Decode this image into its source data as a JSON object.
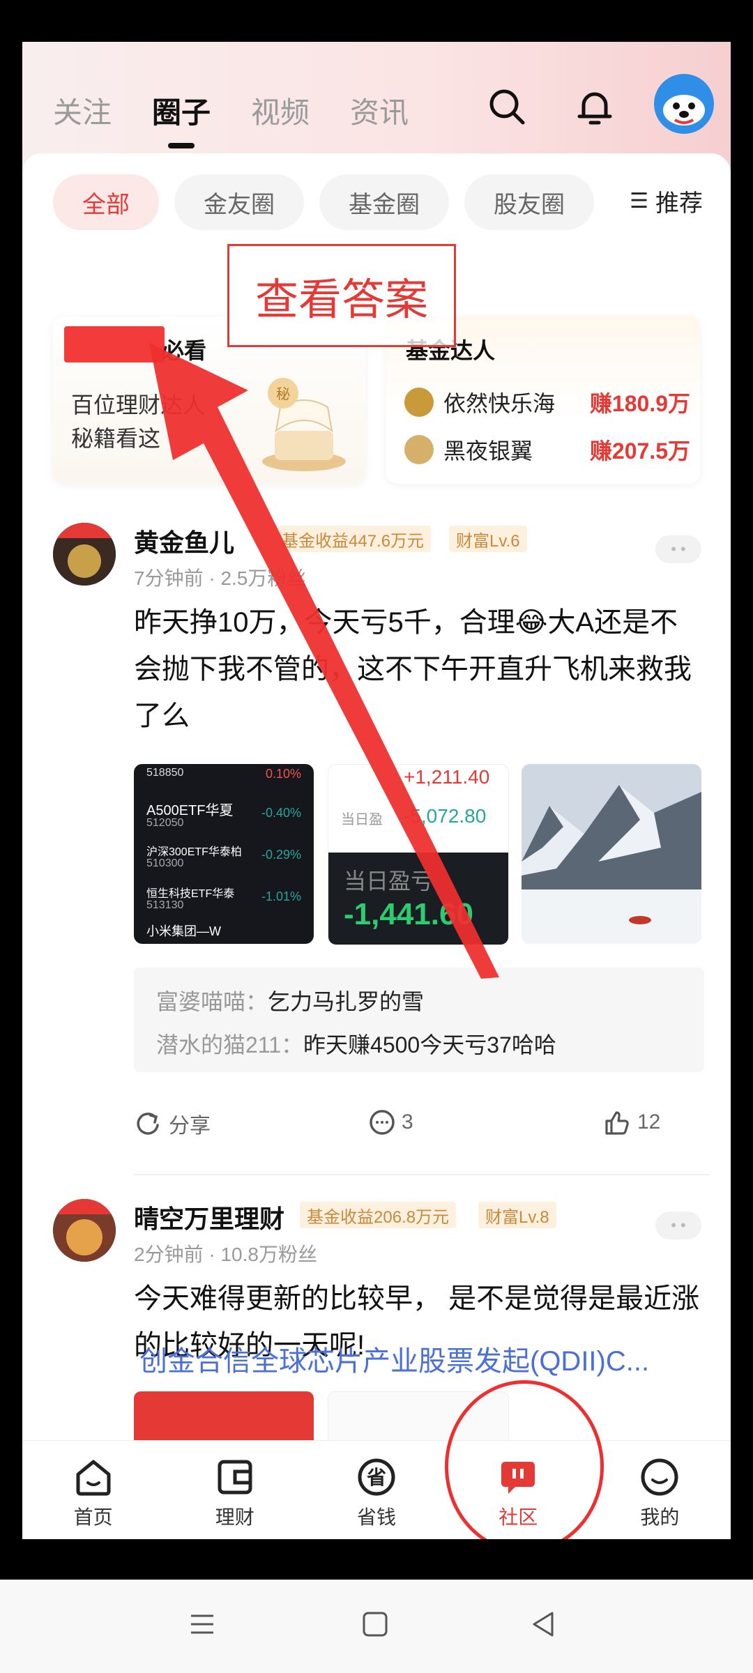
{
  "header": {
    "tabs": [
      "关注",
      "圈子",
      "视频",
      "资讯"
    ],
    "active_tab": "圈子"
  },
  "chips": [
    "全部",
    "金友圈",
    "基金圈",
    "股友圈"
  ],
  "sort_label": "推荐",
  "overlay_label": "查看答案",
  "card_left": {
    "title": "必看",
    "line1": "百位理财达人",
    "line2": "秘籍看这"
  },
  "card_right": {
    "title": "基金达人",
    "masters": [
      {
        "name": "依然快乐海",
        "earn": "赚180.9万"
      },
      {
        "name": "黑夜银翼",
        "earn": "赚207.5万"
      }
    ]
  },
  "posts": [
    {
      "author": "黄金鱼儿",
      "badge_fund": "基金收益447.6万元",
      "badge_level": "财富Lv.6",
      "meta": "7分钟前 · 2.5万粉丝",
      "text": "昨天挣10万，今天亏5千，合理😂大A还是不会抛下我不管的，这不下午开直升飞机来救我了么",
      "comments": [
        {
          "user": "富婆喵喵：",
          "text": "乞力马扎罗的雪"
        },
        {
          "user": "潜水的猫211：",
          "text": "昨天赚4500今天亏37哈哈"
        }
      ],
      "actions": {
        "share": "分享",
        "comments": "3",
        "likes": "12"
      }
    },
    {
      "author": "晴空万里理财",
      "badge_fund": "基金收益206.8万元",
      "badge_level": "财富Lv.8",
      "meta": "2分钟前 · 10.8万粉丝",
      "text": "今天难得更新的比较早， 是不是觉得是最近涨的比较好的一天呢!",
      "link": "创金合信全球芯片产业股票发起(QDII)C..."
    }
  ],
  "thumb1": {
    "rows": [
      {
        "name": "A500ETF华夏",
        "code": "512050",
        "pct": "-0.40%"
      },
      {
        "name": "沪深300ETF华泰柏",
        "code": "510300",
        "pct": "-0.29%"
      },
      {
        "name": "恒生科技ETF华泰",
        "code": "513130",
        "pct": "-1.01%"
      },
      {
        "name": "小米集团—W",
        "code": "",
        "pct": ""
      }
    ],
    "top_pct": "0.10%"
  },
  "thumb2": {
    "val1": "+1,211.40",
    "label2": "当日盈",
    "val2": "-5,072.80",
    "label3": "当日盈亏",
    "val3": "-1,441.60"
  },
  "bottom_nav": [
    "首页",
    "理财",
    "省钱",
    "社区",
    "我的"
  ],
  "colors": {
    "accent": "#e53935",
    "link": "#4a6fd8",
    "badge": "#c9893a"
  }
}
